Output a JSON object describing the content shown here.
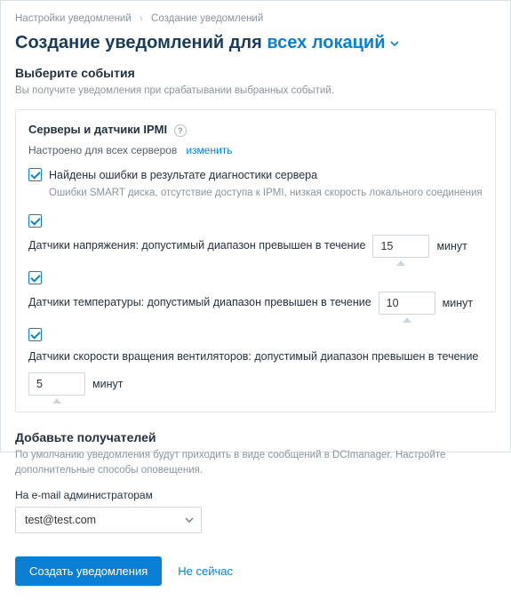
{
  "breadcrumbs": {
    "parent": "Настройки уведомлений",
    "current": "Создание уведомлений"
  },
  "title": {
    "prefix": "Создание уведомлений для ",
    "scope": "всех локаций"
  },
  "events": {
    "heading": "Выберите события",
    "hint": "Вы получите уведомления при срабатывании выбранных событий."
  },
  "card": {
    "title": "Серверы и датчики IPMI",
    "scope_text": "Настроено для всех серверов",
    "change_link": "изменить",
    "rows": {
      "diag": {
        "label": "Найдены ошибки в результате диагностики сервера",
        "desc": "Ошибки SMART диска, отсутствие доступа к IPMI, низкая скорость локального соединения"
      },
      "voltage": {
        "label": "Датчики напряжения: допустимый диапазон превышен в течение",
        "value": "15",
        "unit": "минут"
      },
      "temp": {
        "label": "Датчики температуры: допустимый диапазон превышен в течение",
        "value": "10",
        "unit": "минут"
      },
      "fan": {
        "label": "Датчики скорости вращения вентиляторов: допустимый диапазон превышен в течение",
        "value": "5",
        "unit": "минут"
      }
    }
  },
  "recipients": {
    "heading": "Добавьте получателей",
    "hint": "По умолчанию уведомления будут приходить в виде сообщений в DCImanager. Настройте дополнительные способы оповещения.",
    "email_label": "На e-mail администраторам",
    "email_value": "test@test.com"
  },
  "actions": {
    "submit": "Создать уведомления",
    "cancel": "Не сейчас"
  }
}
